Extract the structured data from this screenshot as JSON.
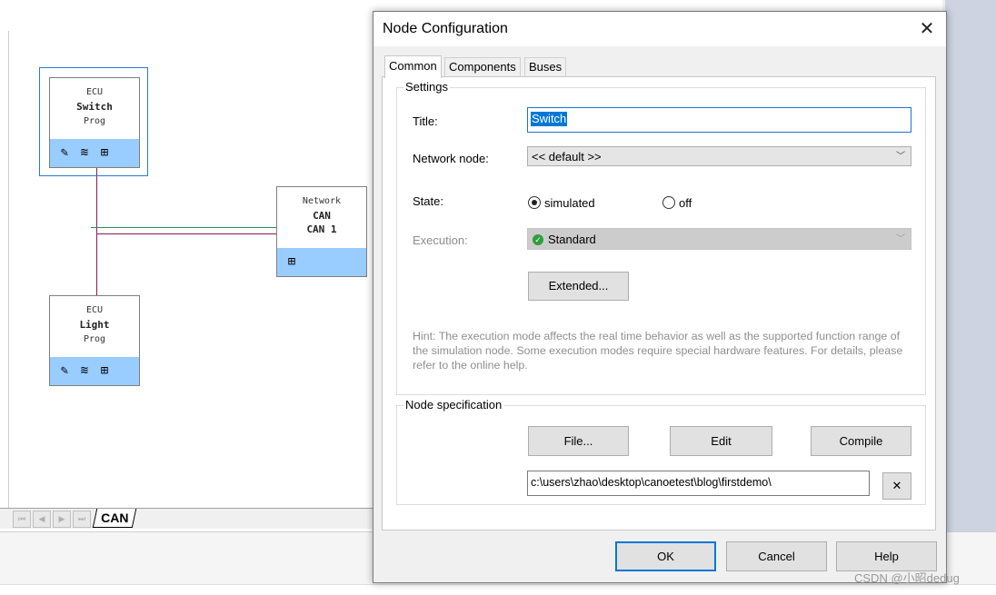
{
  "dialog": {
    "title": "Node Configuration",
    "close_glyph": "✕",
    "tabs": [
      "Common",
      "Components",
      "Buses"
    ],
    "active_tab": "Common",
    "settings": {
      "group_label": "Settings",
      "title_label": "Title:",
      "title_value": "Switch",
      "network_node_label": "Network node:",
      "network_node_value": "<< default >>",
      "state_label": "State:",
      "state_options": [
        "simulated",
        "off"
      ],
      "state_selected": "simulated",
      "execution_label": "Execution:",
      "execution_value": "Standard",
      "extended_button": "Extended...",
      "hint": "Hint: The execution mode affects the real time behavior as well as the supported function range of the simulation node. Some execution modes require special hardware features. For details, please refer to the online help."
    },
    "node_spec": {
      "group_label": "Node specification",
      "file_button": "File...",
      "edit_button": "Edit",
      "compile_button": "Compile",
      "path_value": "c:\\users\\zhao\\desktop\\canoetest\\blog\\firstdemo\\",
      "clear_glyph": "✕"
    },
    "footer": {
      "ok": "OK",
      "cancel": "Cancel",
      "help": "Help"
    }
  },
  "canvas": {
    "nodes": {
      "switch": {
        "type": "ECU",
        "name": "Switch",
        "kind": "Prog"
      },
      "light": {
        "type": "ECU",
        "name": "Light",
        "kind": "Prog"
      },
      "network": {
        "type": "Network",
        "bus": "CAN",
        "channel": "CAN 1"
      }
    },
    "sheet_tab": "CAN",
    "colors": {
      "node_icon_bar": "#99ccff",
      "bus_wire": "#8b1a5a",
      "bus_wire_2": "#2e8b57"
    }
  },
  "watermark": "CSDN @小昭dedug"
}
